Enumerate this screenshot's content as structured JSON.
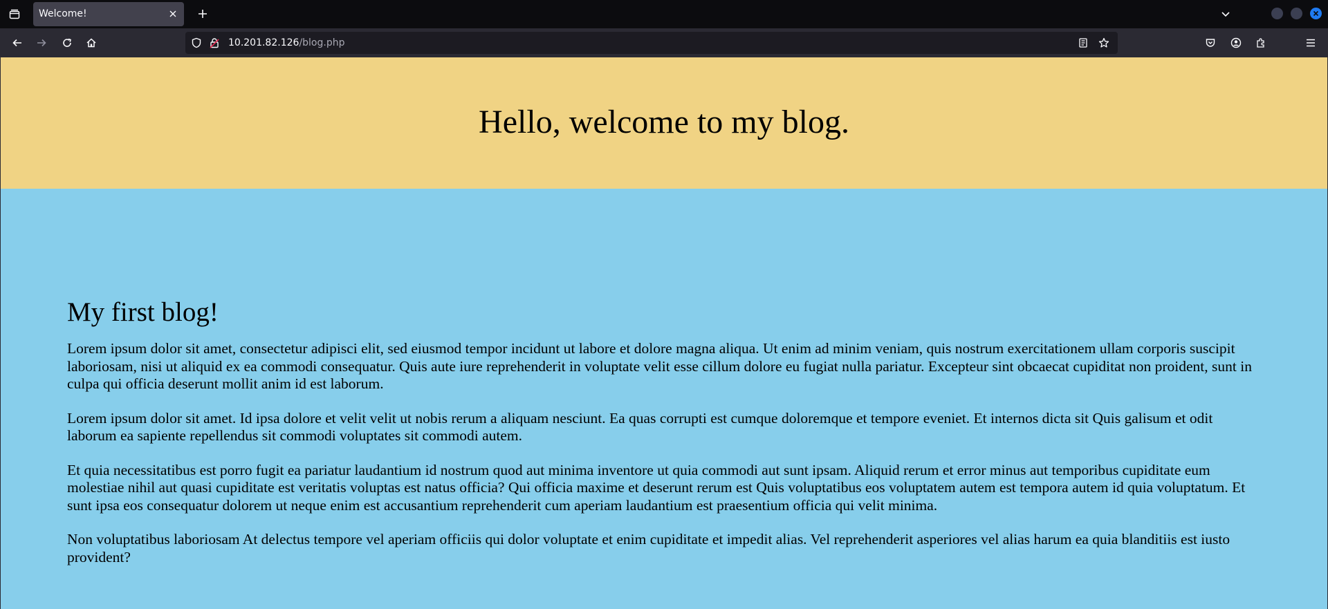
{
  "browser": {
    "tab_title": "Welcome!",
    "url_host": "10.201.82.126",
    "url_path": "/blog.php"
  },
  "page": {
    "header_title": "Hello, welcome to my blog.",
    "colors": {
      "header_bg": "#f0d384",
      "content_bg": "#87ceeb"
    },
    "post": {
      "title": "My first blog!",
      "paragraphs": [
        "Lorem ipsum dolor sit amet, consectetur adipisci elit, sed eiusmod tempor incidunt ut labore et dolore magna aliqua. Ut enim ad minim veniam, quis nostrum exercitationem ullam corporis suscipit laboriosam, nisi ut aliquid ex ea commodi consequatur. Quis aute iure reprehenderit in voluptate velit esse cillum dolore eu fugiat nulla pariatur. Excepteur sint obcaecat cupiditat non proident, sunt in culpa qui officia deserunt mollit anim id est laborum.",
        "Lorem ipsum dolor sit amet. Id ipsa dolore et velit velit ut nobis rerum a aliquam nesciunt. Ea quas corrupti est cumque doloremque et tempore eveniet. Et internos dicta sit Quis galisum et odit laborum ea sapiente repellendus sit commodi voluptates sit commodi autem.",
        "Et quia necessitatibus est porro fugit ea pariatur laudantium id nostrum quod aut minima inventore ut quia commodi aut sunt ipsam. Aliquid rerum et error minus aut temporibus cupiditate eum molestiae nihil aut quasi cupiditate est veritatis voluptas est natus officia? Qui officia maxime et deserunt rerum est Quis voluptatibus eos voluptatem autem est tempora autem id quia voluptatum. Et sunt ipsa eos consequatur dolorem ut neque enim est accusantium reprehenderit cum aperiam laudantium est praesentium officia qui velit minima.",
        "Non voluptatibus laboriosam At delectus tempore vel aperiam officiis qui dolor voluptate et enim cupiditate et impedit alias. Vel reprehenderit asperiores vel alias harum ea quia blanditiis est iusto provident?"
      ]
    }
  },
  "icons": {
    "tab_list": "tab-list-icon",
    "close_tab": "close-icon",
    "new_tab": "plus-icon",
    "list_all_tabs": "chevron-down-icon",
    "back": "back-arrow-icon",
    "forward": "forward-arrow-icon",
    "reload": "reload-icon",
    "home": "home-icon",
    "tracking_protection": "shield-icon",
    "insecure_connection": "insecure-lock-icon",
    "reader_view": "reader-view-icon",
    "bookmark": "star-icon",
    "pocket": "pocket-icon",
    "account": "account-icon",
    "extensions": "extensions-icon",
    "menu": "hamburger-menu-icon"
  }
}
